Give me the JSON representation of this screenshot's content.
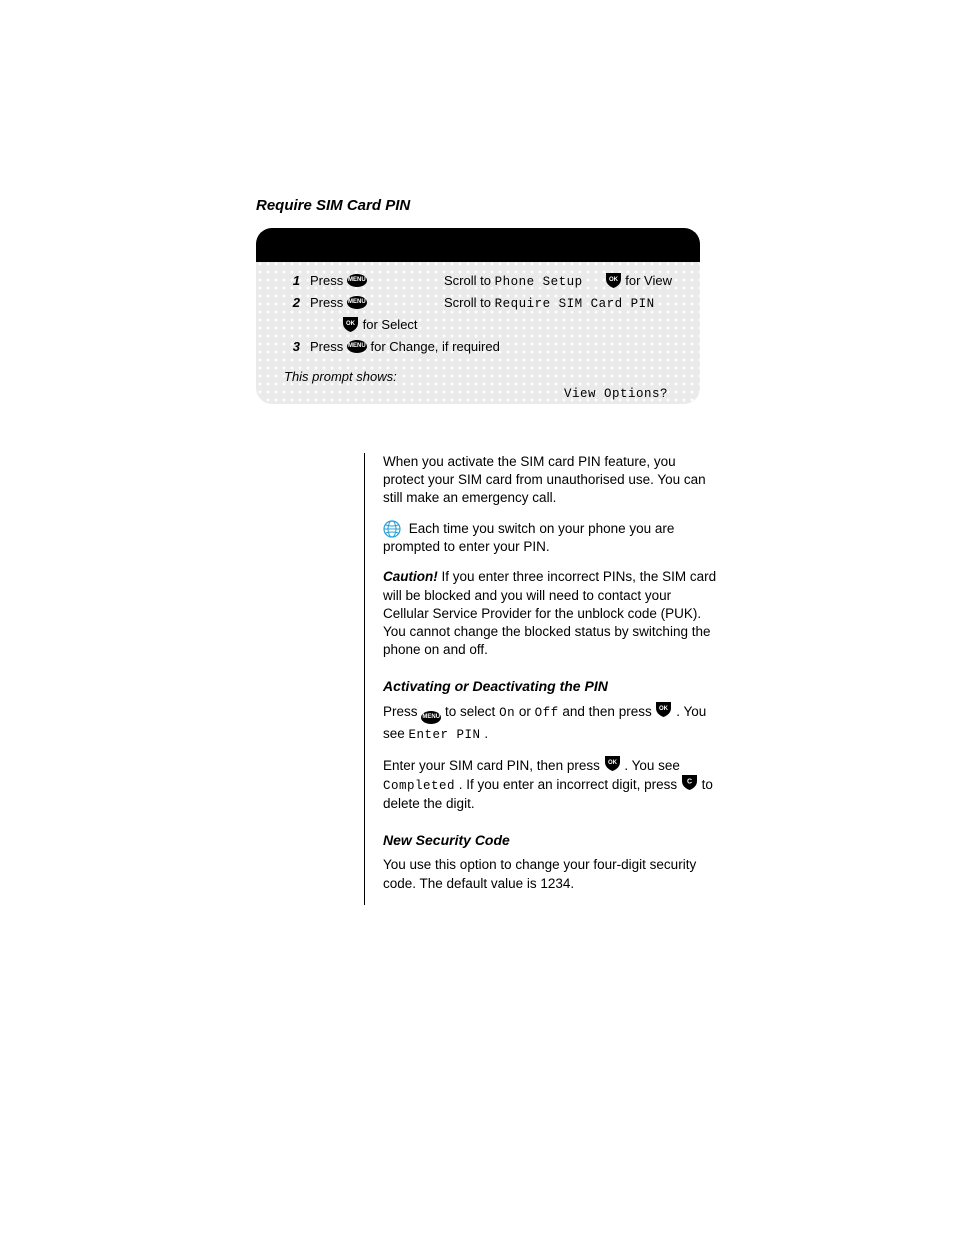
{
  "section_title": "Require SIM Card PIN",
  "shortcut": {
    "steps": [
      {
        "num": "1",
        "left": "Press",
        "icon": "menu",
        "right": "Scroll to",
        "right_mono": "Phone Setup",
        "tail_icon": "ok",
        "tail_text": "for View"
      },
      {
        "num": "2",
        "left": "Press",
        "icon": "menu_ok",
        "right": "Scroll to",
        "right_mono": "Require SIM Card PIN"
      },
      {
        "num": "",
        "left": "",
        "icon": "",
        "right": "for Select"
      },
      {
        "num": "3",
        "left": "Press",
        "icon": "menu",
        "right": "for Change, if required"
      }
    ],
    "prompt": "This prompt shows:",
    "prompt_mono": "View Options?"
  },
  "body": {
    "intro": "When you activate the SIM card PIN feature, you protect your SIM card from unauthorised use. You can still make an emergency call.",
    "note_label": "Each time you switch on your phone you are prompted to enter your PIN.",
    "caution": {
      "label": "Caution!",
      "text": " If you enter three incorrect PINs, the SIM card will be blocked and you will need to contact your Cellular Service Provider for the unblock code (PUK). You cannot change the blocked status by switching the phone on and off."
    },
    "heading1": "Activating or Deactivating the PIN",
    "activate": {
      "line1a": "Press ",
      "line1b": " to select ",
      "on": "On",
      "or": " or ",
      "off": "Off",
      "line1c": " and then press ",
      "line1d": ". You see ",
      "enter_pin": "Enter PIN",
      "line1e": ".",
      "line2a": "Enter your SIM card PIN, then press ",
      "line2b": ". You see ",
      "completed": "Completed",
      "line2c": ". If you enter an incorrect digit, press ",
      "line2d": " to delete the digit."
    },
    "heading2": "New Security Code",
    "newsec": "You use this option to change your four-digit security code. The default value is 1234."
  }
}
